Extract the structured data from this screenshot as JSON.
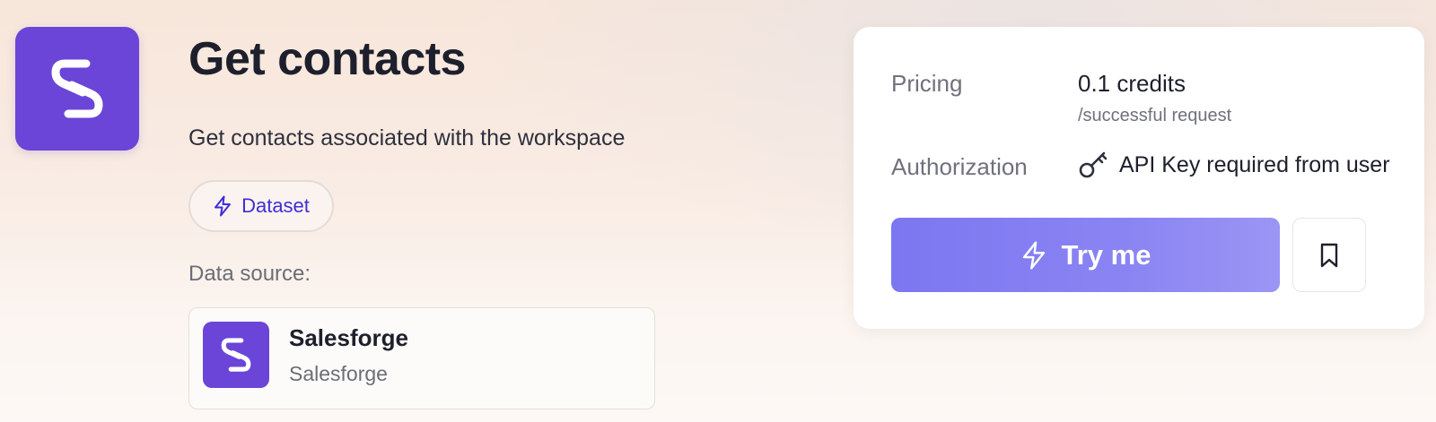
{
  "header": {
    "logo_icon": "salesforge-logo-icon",
    "title": "Get contacts",
    "description": "Get contacts associated with the workspace"
  },
  "tag": {
    "icon": "bolt-icon",
    "label": "Dataset"
  },
  "data_source": {
    "label": "Data source:",
    "name": "Salesforge",
    "subtitle": "Salesforge",
    "icon": "salesforge-logo-icon"
  },
  "panel": {
    "pricing_label": "Pricing",
    "pricing_value": "0.1 credits",
    "pricing_unit": "/successful request",
    "authorization_label": "Authorization",
    "authorization_icon": "key-icon",
    "authorization_value": "API Key required from user",
    "try_button_label": "Try me",
    "try_button_icon": "bolt-icon",
    "bookmark_icon": "bookmark-icon"
  },
  "colors": {
    "brand": "#6a45d8",
    "accent": "#3f2ed6",
    "button": "#8a84f3"
  }
}
